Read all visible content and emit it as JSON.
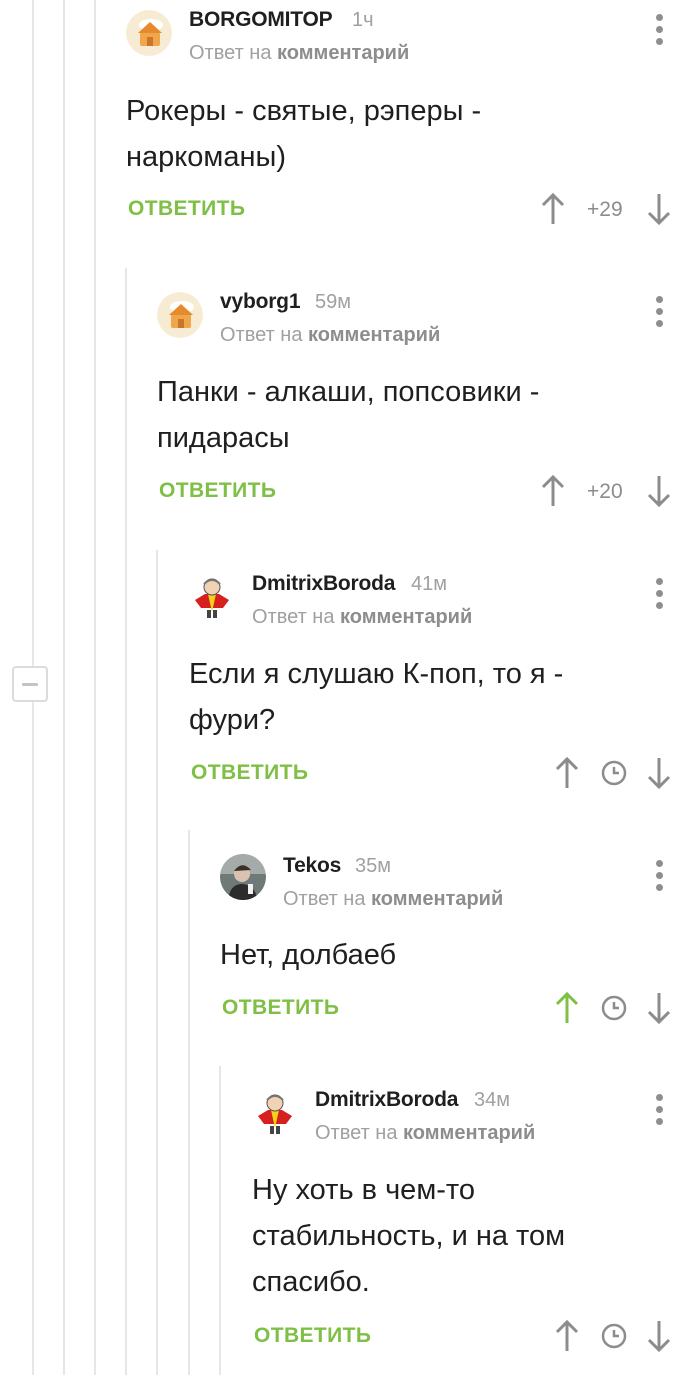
{
  "reply_to": {
    "prefix": "Ответ на",
    "target": "комментарий"
  },
  "reply_label": "ОТВЕТИТЬ",
  "colors": {
    "accent_green": "#7fbf46",
    "text": "#1f1f1f",
    "muted": "#a0a0a0",
    "icon": "#8c8c8c",
    "thread_line": "#e6e6e6"
  },
  "icons": {
    "upvote": "arrow-up-icon",
    "downvote": "arrow-down-icon",
    "timer": "clock-icon",
    "more": "more-vertical-icon",
    "collapse": "minus-icon"
  },
  "comments": [
    {
      "author": "BORGOMITOP",
      "time": "1ч",
      "avatar": "default-avatar-house",
      "lines": [
        "Рокеры - святые, рэперы -",
        "наркоманы)"
      ],
      "rating": "+29",
      "upvoted": false
    },
    {
      "author": "vyborg1",
      "time": "59м",
      "avatar": "default-avatar-house",
      "lines": [
        "Панки - алкаши, попсовики -",
        "пидарасы"
      ],
      "rating": "+20",
      "upvoted": false
    },
    {
      "author": "DmitrixBoroda",
      "time": "41м",
      "avatar": "cartoon-man-avatar",
      "lines": [
        "Если я слушаю К-поп, то я -",
        "фури?"
      ],
      "rating": null,
      "upvoted": false
    },
    {
      "author": "Tekos",
      "time": "35м",
      "avatar": "photo-avatar",
      "lines": [
        "Нет, долбаеб"
      ],
      "rating": null,
      "upvoted": true
    },
    {
      "author": "DmitrixBoroda",
      "time": "34м",
      "avatar": "cartoon-man-avatar",
      "lines": [
        "Ну хоть в чем-то",
        "стабильность, и на том",
        "спасибо."
      ],
      "rating": null,
      "upvoted": false
    }
  ]
}
